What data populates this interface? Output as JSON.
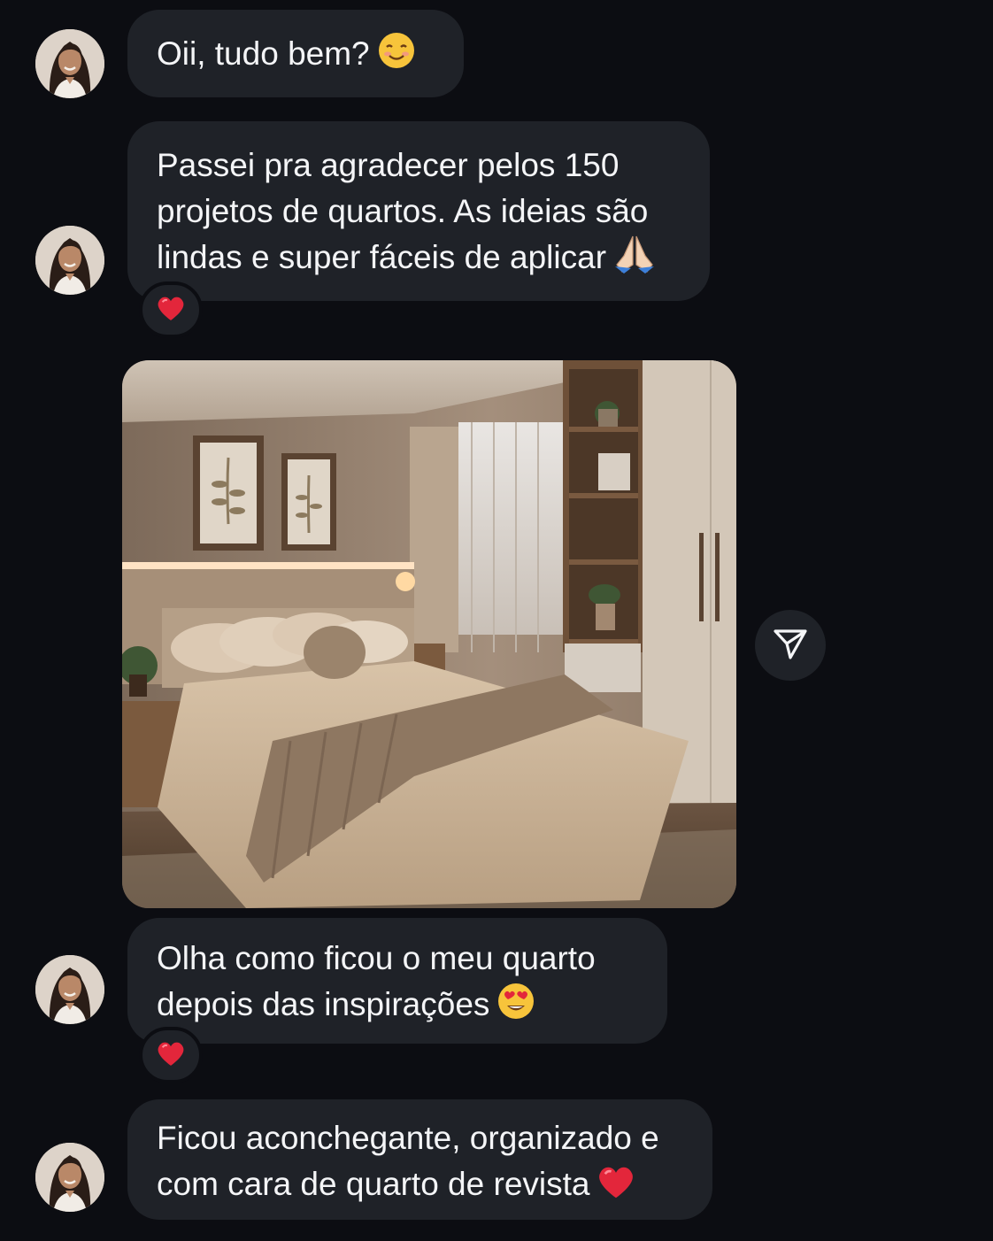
{
  "messages": [
    {
      "text_lines": [
        "Oii, tudo bem?"
      ],
      "emoji": "smiling-face-icon"
    },
    {
      "text_lines": [
        "Passei pra agradecer pelos 150",
        "projetos de quartos. As ideias são",
        "lindas e super fáceis de aplicar"
      ],
      "emoji": "folded-hands-icon",
      "reaction": "heart-icon"
    },
    {
      "text_lines": [
        "Olha como ficou o meu quarto",
        "depois das inspirações"
      ],
      "emoji": "heart-eyes-icon",
      "reaction": "heart-icon"
    },
    {
      "text_lines": [
        "Ficou aconchegante, organizado e",
        "com cara de quarto de revista"
      ],
      "emoji": "heart-icon"
    }
  ],
  "photo": {
    "subject": "bedroom-photo"
  },
  "share_button": {
    "icon": "send-icon"
  },
  "colors": {
    "background": "#0c0d12",
    "bubble": "#1f2228",
    "text": "#f4f5f7",
    "heart": "#e3263b"
  }
}
